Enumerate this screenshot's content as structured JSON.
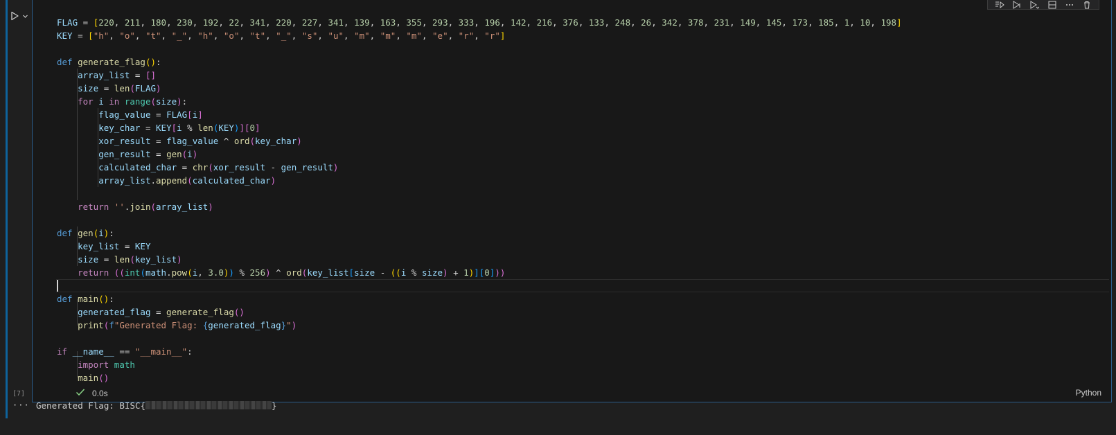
{
  "cell": {
    "execution_count": "[7]",
    "status_time": "0.0s",
    "language": "Python",
    "code_lines": [
      [
        [
          "var",
          "FLAG"
        ],
        [
          "op",
          " = "
        ],
        [
          "b1",
          "["
        ],
        [
          "num",
          "220"
        ],
        [
          "op",
          ", "
        ],
        [
          "num",
          "211"
        ],
        [
          "op",
          ", "
        ],
        [
          "num",
          "180"
        ],
        [
          "op",
          ", "
        ],
        [
          "num",
          "230"
        ],
        [
          "op",
          ", "
        ],
        [
          "num",
          "192"
        ],
        [
          "op",
          ", "
        ],
        [
          "num",
          "22"
        ],
        [
          "op",
          ", "
        ],
        [
          "num",
          "341"
        ],
        [
          "op",
          ", "
        ],
        [
          "num",
          "220"
        ],
        [
          "op",
          ", "
        ],
        [
          "num",
          "227"
        ],
        [
          "op",
          ", "
        ],
        [
          "num",
          "341"
        ],
        [
          "op",
          ", "
        ],
        [
          "num",
          "139"
        ],
        [
          "op",
          ", "
        ],
        [
          "num",
          "163"
        ],
        [
          "op",
          ", "
        ],
        [
          "num",
          "355"
        ],
        [
          "op",
          ", "
        ],
        [
          "num",
          "293"
        ],
        [
          "op",
          ", "
        ],
        [
          "num",
          "333"
        ],
        [
          "op",
          ", "
        ],
        [
          "num",
          "196"
        ],
        [
          "op",
          ", "
        ],
        [
          "num",
          "142"
        ],
        [
          "op",
          ", "
        ],
        [
          "num",
          "216"
        ],
        [
          "op",
          ", "
        ],
        [
          "num",
          "376"
        ],
        [
          "op",
          ", "
        ],
        [
          "num",
          "133"
        ],
        [
          "op",
          ", "
        ],
        [
          "num",
          "248"
        ],
        [
          "op",
          ", "
        ],
        [
          "num",
          "26"
        ],
        [
          "op",
          ", "
        ],
        [
          "num",
          "342"
        ],
        [
          "op",
          ", "
        ],
        [
          "num",
          "378"
        ],
        [
          "op",
          ", "
        ],
        [
          "num",
          "231"
        ],
        [
          "op",
          ", "
        ],
        [
          "num",
          "149"
        ],
        [
          "op",
          ", "
        ],
        [
          "num",
          "145"
        ],
        [
          "op",
          ", "
        ],
        [
          "num",
          "173"
        ],
        [
          "op",
          ", "
        ],
        [
          "num",
          "185"
        ],
        [
          "op",
          ", "
        ],
        [
          "num",
          "1"
        ],
        [
          "op",
          ", "
        ],
        [
          "num",
          "10"
        ],
        [
          "op",
          ", "
        ],
        [
          "num",
          "198"
        ],
        [
          "b1",
          "]"
        ]
      ],
      [
        [
          "var",
          "KEY"
        ],
        [
          "op",
          " = "
        ],
        [
          "b1",
          "["
        ],
        [
          "str",
          "\"h\""
        ],
        [
          "op",
          ", "
        ],
        [
          "str",
          "\"o\""
        ],
        [
          "op",
          ", "
        ],
        [
          "str",
          "\"t\""
        ],
        [
          "op",
          ", "
        ],
        [
          "str",
          "\"_\""
        ],
        [
          "op",
          ", "
        ],
        [
          "str",
          "\"h\""
        ],
        [
          "op",
          ", "
        ],
        [
          "str",
          "\"o\""
        ],
        [
          "op",
          ", "
        ],
        [
          "str",
          "\"t\""
        ],
        [
          "op",
          ", "
        ],
        [
          "str",
          "\"_\""
        ],
        [
          "op",
          ", "
        ],
        [
          "str",
          "\"s\""
        ],
        [
          "op",
          ", "
        ],
        [
          "str",
          "\"u\""
        ],
        [
          "op",
          ", "
        ],
        [
          "str",
          "\"m\""
        ],
        [
          "op",
          ", "
        ],
        [
          "str",
          "\"m\""
        ],
        [
          "op",
          ", "
        ],
        [
          "str",
          "\"m\""
        ],
        [
          "op",
          ", "
        ],
        [
          "str",
          "\"e\""
        ],
        [
          "op",
          ", "
        ],
        [
          "str",
          "\"r\""
        ],
        [
          "op",
          ", "
        ],
        [
          "str",
          "\"r\""
        ],
        [
          "b1",
          "]"
        ]
      ],
      [],
      [
        [
          "kw",
          "def "
        ],
        [
          "fn",
          "generate_flag"
        ],
        [
          "b1",
          "()"
        ],
        [
          "op",
          ":"
        ]
      ],
      [
        [
          "op",
          "    "
        ],
        [
          "var",
          "array_list"
        ],
        [
          "op",
          " = "
        ],
        [
          "b2",
          "[]"
        ]
      ],
      [
        [
          "op",
          "    "
        ],
        [
          "var",
          "size"
        ],
        [
          "op",
          " = "
        ],
        [
          "fn",
          "len"
        ],
        [
          "b2",
          "("
        ],
        [
          "var",
          "FLAG"
        ],
        [
          "b2",
          ")"
        ]
      ],
      [
        [
          "op",
          "    "
        ],
        [
          "ctl",
          "for "
        ],
        [
          "var",
          "i"
        ],
        [
          "ctl",
          " in "
        ],
        [
          "cls",
          "range"
        ],
        [
          "b2",
          "("
        ],
        [
          "var",
          "size"
        ],
        [
          "b2",
          ")"
        ],
        [
          "op",
          ":"
        ]
      ],
      [
        [
          "op",
          "        "
        ],
        [
          "var",
          "flag_value"
        ],
        [
          "op",
          " = "
        ],
        [
          "var",
          "FLAG"
        ],
        [
          "b2",
          "["
        ],
        [
          "var",
          "i"
        ],
        [
          "b2",
          "]"
        ]
      ],
      [
        [
          "op",
          "        "
        ],
        [
          "var",
          "key_char"
        ],
        [
          "op",
          " = "
        ],
        [
          "var",
          "KEY"
        ],
        [
          "b2",
          "["
        ],
        [
          "var",
          "i"
        ],
        [
          "op",
          " % "
        ],
        [
          "fn",
          "len"
        ],
        [
          "b3",
          "("
        ],
        [
          "var",
          "KEY"
        ],
        [
          "b3",
          ")"
        ],
        [
          "b2",
          "]"
        ],
        [
          "b2",
          "["
        ],
        [
          "num",
          "0"
        ],
        [
          "b2",
          "]"
        ]
      ],
      [
        [
          "op",
          "        "
        ],
        [
          "var",
          "xor_result"
        ],
        [
          "op",
          " = "
        ],
        [
          "var",
          "flag_value"
        ],
        [
          "op",
          " ^ "
        ],
        [
          "fn",
          "ord"
        ],
        [
          "b2",
          "("
        ],
        [
          "var",
          "key_char"
        ],
        [
          "b2",
          ")"
        ]
      ],
      [
        [
          "op",
          "        "
        ],
        [
          "var",
          "gen_result"
        ],
        [
          "op",
          " = "
        ],
        [
          "fn",
          "gen"
        ],
        [
          "b2",
          "("
        ],
        [
          "var",
          "i"
        ],
        [
          "b2",
          ")"
        ]
      ],
      [
        [
          "op",
          "        "
        ],
        [
          "var",
          "calculated_char"
        ],
        [
          "op",
          " = "
        ],
        [
          "fn",
          "chr"
        ],
        [
          "b2",
          "("
        ],
        [
          "var",
          "xor_result"
        ],
        [
          "op",
          " - "
        ],
        [
          "var",
          "gen_result"
        ],
        [
          "b2",
          ")"
        ]
      ],
      [
        [
          "op",
          "        "
        ],
        [
          "var",
          "array_list"
        ],
        [
          "op",
          "."
        ],
        [
          "fn",
          "append"
        ],
        [
          "b2",
          "("
        ],
        [
          "var",
          "calculated_char"
        ],
        [
          "b2",
          ")"
        ]
      ],
      [],
      [
        [
          "op",
          "    "
        ],
        [
          "ctl",
          "return "
        ],
        [
          "str",
          "''"
        ],
        [
          "op",
          "."
        ],
        [
          "fn",
          "join"
        ],
        [
          "b2",
          "("
        ],
        [
          "var",
          "array_list"
        ],
        [
          "b2",
          ")"
        ]
      ],
      [],
      [
        [
          "kw",
          "def "
        ],
        [
          "fn",
          "gen"
        ],
        [
          "b1",
          "("
        ],
        [
          "var",
          "i"
        ],
        [
          "b1",
          ")"
        ],
        [
          "op",
          ":"
        ]
      ],
      [
        [
          "op",
          "    "
        ],
        [
          "var",
          "key_list"
        ],
        [
          "op",
          " = "
        ],
        [
          "var",
          "KEY"
        ]
      ],
      [
        [
          "op",
          "    "
        ],
        [
          "var",
          "size"
        ],
        [
          "op",
          " = "
        ],
        [
          "fn",
          "len"
        ],
        [
          "b2",
          "("
        ],
        [
          "var",
          "key_list"
        ],
        [
          "b2",
          ")"
        ]
      ],
      [
        [
          "op",
          "    "
        ],
        [
          "ctl",
          "return "
        ],
        [
          "b2",
          "(("
        ],
        [
          "cls",
          "int"
        ],
        [
          "b3",
          "("
        ],
        [
          "var",
          "math"
        ],
        [
          "op",
          "."
        ],
        [
          "fn",
          "pow"
        ],
        [
          "b1",
          "("
        ],
        [
          "var",
          "i"
        ],
        [
          "op",
          ", "
        ],
        [
          "num",
          "3.0"
        ],
        [
          "b1",
          ")"
        ],
        [
          "b3",
          ")"
        ],
        [
          "op",
          " % "
        ],
        [
          "num",
          "256"
        ],
        [
          "b2",
          ")"
        ],
        [
          "op",
          " ^ "
        ],
        [
          "fn",
          "ord"
        ],
        [
          "b2",
          "("
        ],
        [
          "var",
          "key_list"
        ],
        [
          "b3",
          "["
        ],
        [
          "var",
          "size"
        ],
        [
          "op",
          " - "
        ],
        [
          "b1",
          "(("
        ],
        [
          "var",
          "i"
        ],
        [
          "op",
          " % "
        ],
        [
          "var",
          "size"
        ],
        [
          "b2",
          ")"
        ],
        [
          "op",
          " + "
        ],
        [
          "num",
          "1"
        ],
        [
          "b1",
          ")"
        ],
        [
          "b3",
          "]"
        ],
        [
          "b3",
          "["
        ],
        [
          "num",
          "0"
        ],
        [
          "b3",
          "]"
        ],
        [
          "b2",
          "))"
        ]
      ],
      [],
      [
        [
          "kw",
          "def "
        ],
        [
          "fn",
          "main"
        ],
        [
          "b1",
          "()"
        ],
        [
          "op",
          ":"
        ]
      ],
      [
        [
          "op",
          "    "
        ],
        [
          "var",
          "generated_flag"
        ],
        [
          "op",
          " = "
        ],
        [
          "fn",
          "generate_flag"
        ],
        [
          "b2",
          "()"
        ]
      ],
      [
        [
          "op",
          "    "
        ],
        [
          "fn",
          "print"
        ],
        [
          "b2",
          "("
        ],
        [
          "kw",
          "f"
        ],
        [
          "str",
          "\"Generated Flag: "
        ],
        [
          "kw",
          "{"
        ],
        [
          "var",
          "generated_flag"
        ],
        [
          "kw",
          "}"
        ],
        [
          "str",
          "\""
        ],
        [
          "b2",
          ")"
        ]
      ],
      [],
      [
        [
          "ctl",
          "if "
        ],
        [
          "var",
          "__name__"
        ],
        [
          "op",
          " == "
        ],
        [
          "str",
          "\"__main__\""
        ],
        [
          "op",
          ":"
        ]
      ],
      [
        [
          "op",
          "    "
        ],
        [
          "ctl",
          "import "
        ],
        [
          "cls",
          "math"
        ]
      ],
      [
        [
          "op",
          "    "
        ],
        [
          "fn",
          "main"
        ],
        [
          "b2",
          "()"
        ]
      ]
    ]
  },
  "output": {
    "ellipsis": "···",
    "prefix": "Generated Flag: BISC{",
    "suffix": "}"
  },
  "icons": {
    "run": "run-icon",
    "expand": "chevron-down-icon",
    "check": "check-icon"
  }
}
